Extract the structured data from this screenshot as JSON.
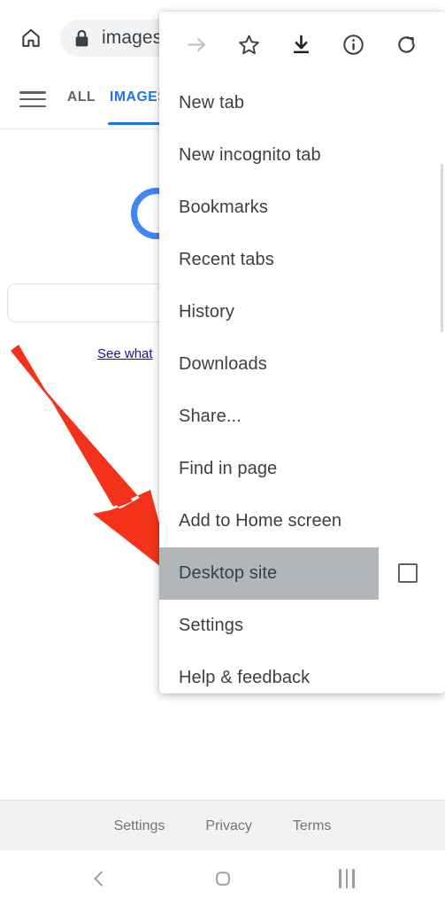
{
  "browser": {
    "toolbar": {
      "home_icon": "home-icon",
      "lock_icon": "lock-icon",
      "url_text": "images"
    },
    "tabs": {
      "menu_icon": "hamburger-icon",
      "items": [
        {
          "label": "ALL",
          "active": false
        },
        {
          "label": "IMAGES",
          "active": true
        }
      ]
    },
    "page": {
      "logo": "google-logo-circle",
      "search_placeholder": "",
      "see_what_link": "See what"
    },
    "footer": {
      "links": [
        "Settings",
        "Privacy",
        "Terms"
      ]
    }
  },
  "menu": {
    "icon_row": [
      {
        "name": "forward-arrow-icon",
        "label": "Forward",
        "disabled": true
      },
      {
        "name": "star-icon",
        "label": "Bookmark",
        "disabled": false
      },
      {
        "name": "download-icon",
        "label": "Download",
        "disabled": false
      },
      {
        "name": "info-icon",
        "label": "Page info",
        "disabled": false
      },
      {
        "name": "reload-icon",
        "label": "Reload",
        "disabled": false
      }
    ],
    "items": [
      {
        "label": "New tab",
        "highlighted": false,
        "checkbox": false
      },
      {
        "label": "New incognito tab",
        "highlighted": false,
        "checkbox": false
      },
      {
        "label": "Bookmarks",
        "highlighted": false,
        "checkbox": false
      },
      {
        "label": "Recent tabs",
        "highlighted": false,
        "checkbox": false
      },
      {
        "label": "History",
        "highlighted": false,
        "checkbox": false
      },
      {
        "label": "Downloads",
        "highlighted": false,
        "checkbox": false
      },
      {
        "label": "Share...",
        "highlighted": false,
        "checkbox": false
      },
      {
        "label": "Find in page",
        "highlighted": false,
        "checkbox": false
      },
      {
        "label": "Add to Home screen",
        "highlighted": false,
        "checkbox": false
      },
      {
        "label": "Desktop site",
        "highlighted": true,
        "checkbox": true,
        "checked": false
      },
      {
        "label": "Settings",
        "highlighted": false,
        "checkbox": false
      },
      {
        "label": "Help & feedback",
        "highlighted": false,
        "checkbox": false
      }
    ]
  },
  "annotation": {
    "arrow_color": "#F4321C",
    "points_to": "Desktop site"
  },
  "android_navbar": {
    "back": "back-icon",
    "home": "home-icon",
    "recents": "recents-icon"
  },
  "colors": {
    "accent_blue": "#1a73e8",
    "logo_blue": "#4285f4",
    "highlight_gray": "#b3b6b9",
    "link_blue": "#1a0dab",
    "arrow_red": "#F4321C"
  }
}
